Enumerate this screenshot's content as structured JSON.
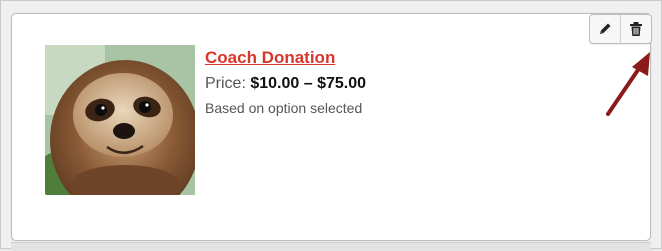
{
  "product": {
    "title": "Coach Donation",
    "price_label": "Price:",
    "price_value": "$10.00 – $75.00",
    "note": "Based on option selected",
    "image_subject": "sloth-photo"
  },
  "toolbar": {
    "edit_icon": "pencil-icon",
    "delete_icon": "trash-icon"
  },
  "annotation": {
    "arrow_color": "#8b1a1a"
  }
}
